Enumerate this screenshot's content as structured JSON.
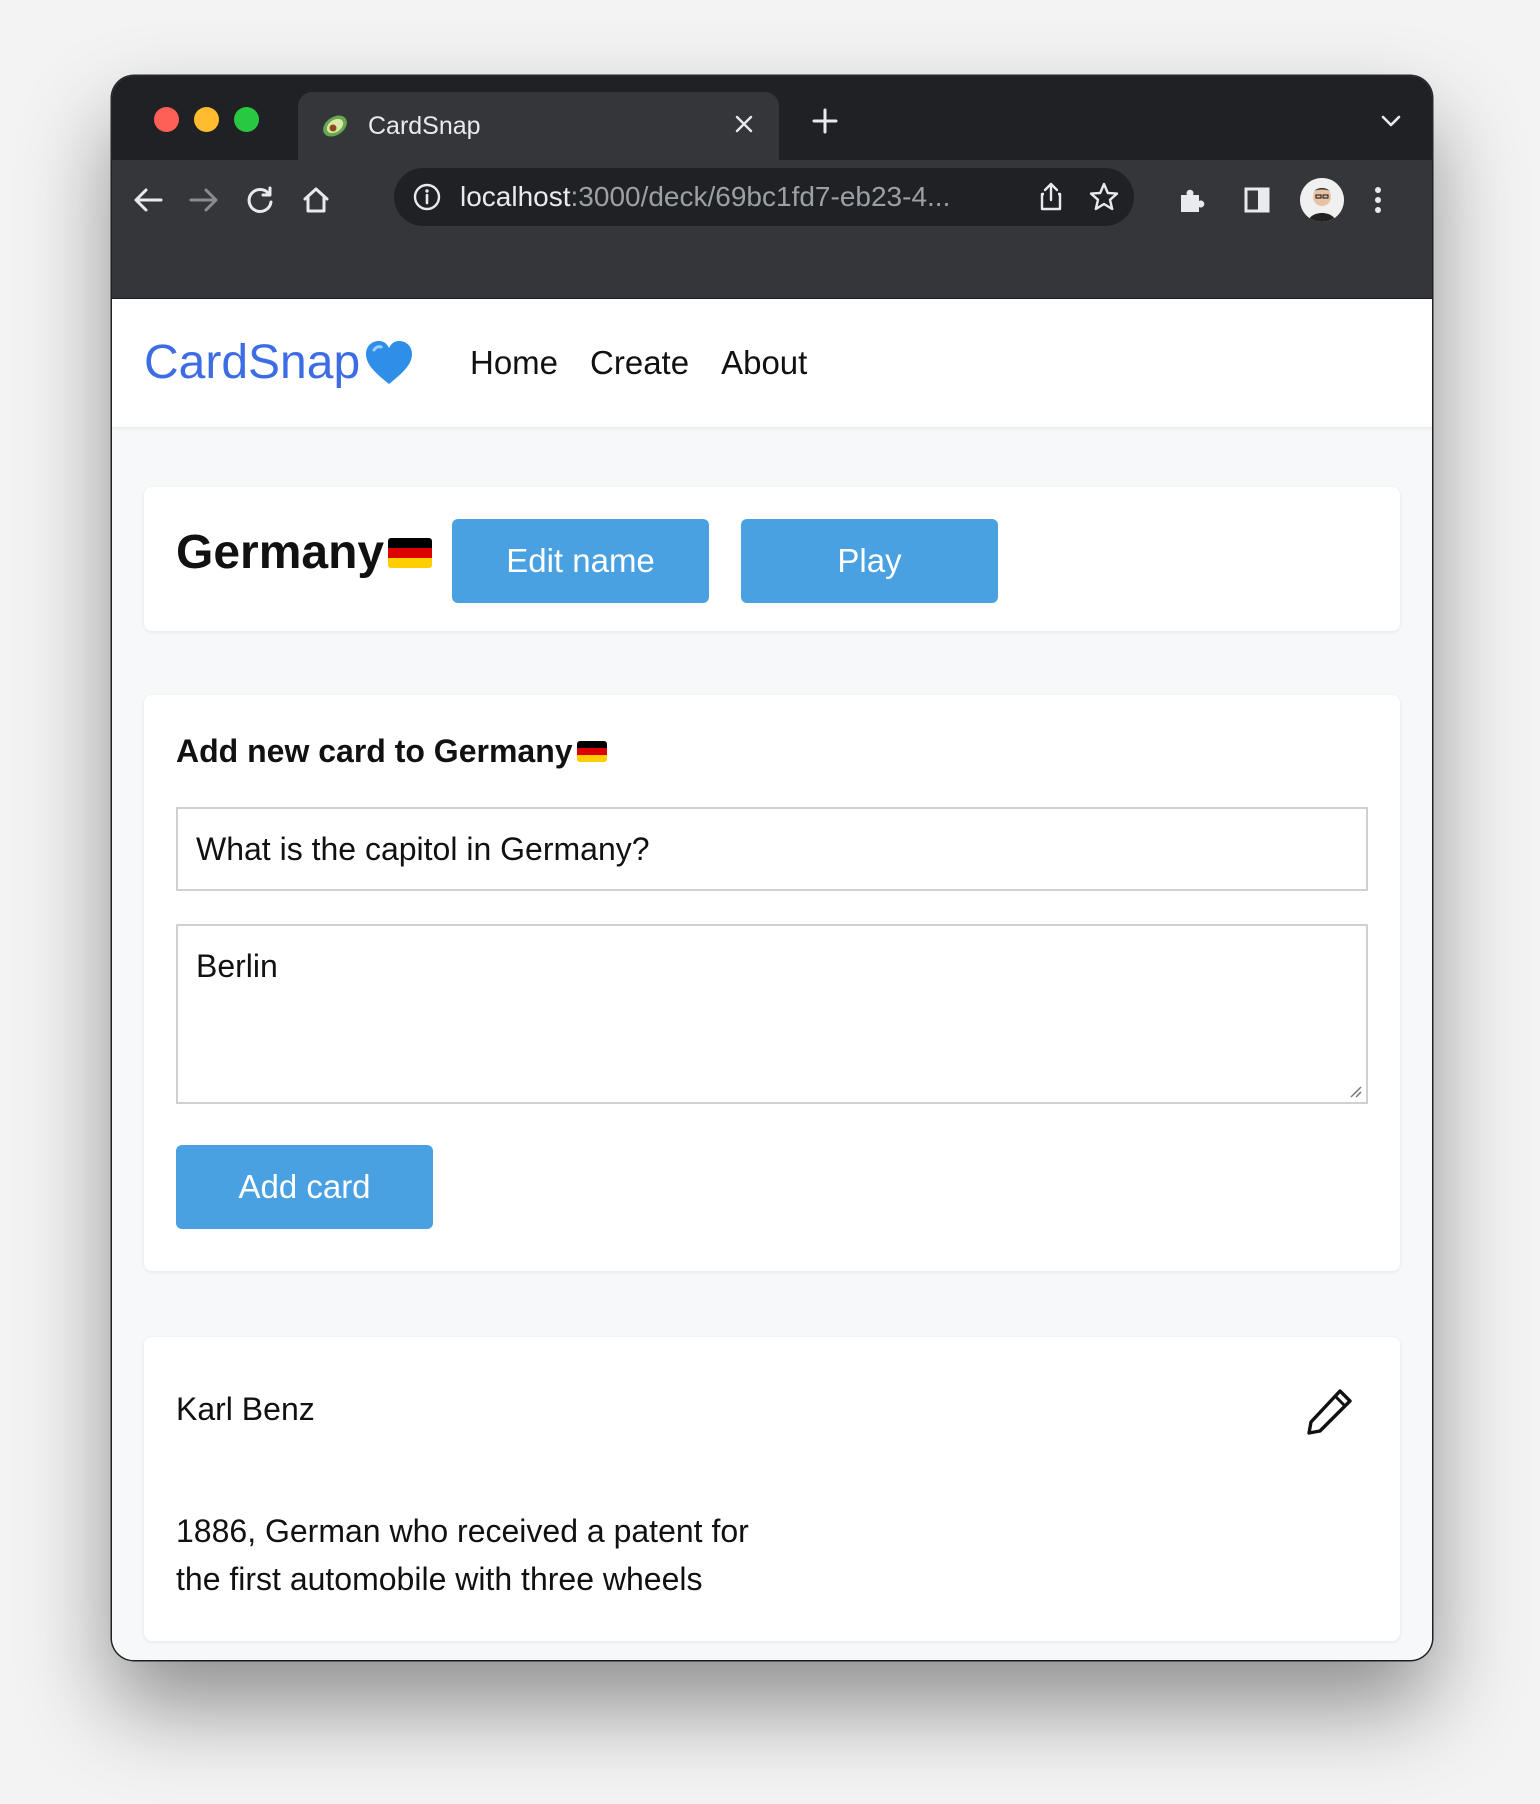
{
  "browser": {
    "tab_title": "CardSnap",
    "url_host": "localhost",
    "url_rest": ":3000/deck/69bc1fd7-eb23-4..."
  },
  "nav": {
    "brand": "CardSnap",
    "brand_emoji_icon": "blue-heart-icon",
    "links": [
      "Home",
      "Create",
      "About"
    ]
  },
  "deck": {
    "title": "Germany",
    "flag_icon": "germany-flag-icon",
    "edit_label": "Edit name",
    "play_label": "Play"
  },
  "add_form": {
    "heading": "Add new card to Germany",
    "question_value": "What is the capitol in Germany?",
    "answer_value": "Berlin",
    "submit_label": "Add card"
  },
  "cards": [
    {
      "question": "Karl Benz",
      "answer": "1886, German who received a patent for the first automobile with three wheels"
    }
  ],
  "colors": {
    "brand": "#3d6de4",
    "button": "#4aa1e1",
    "page_bg": "#f7f8fa"
  }
}
